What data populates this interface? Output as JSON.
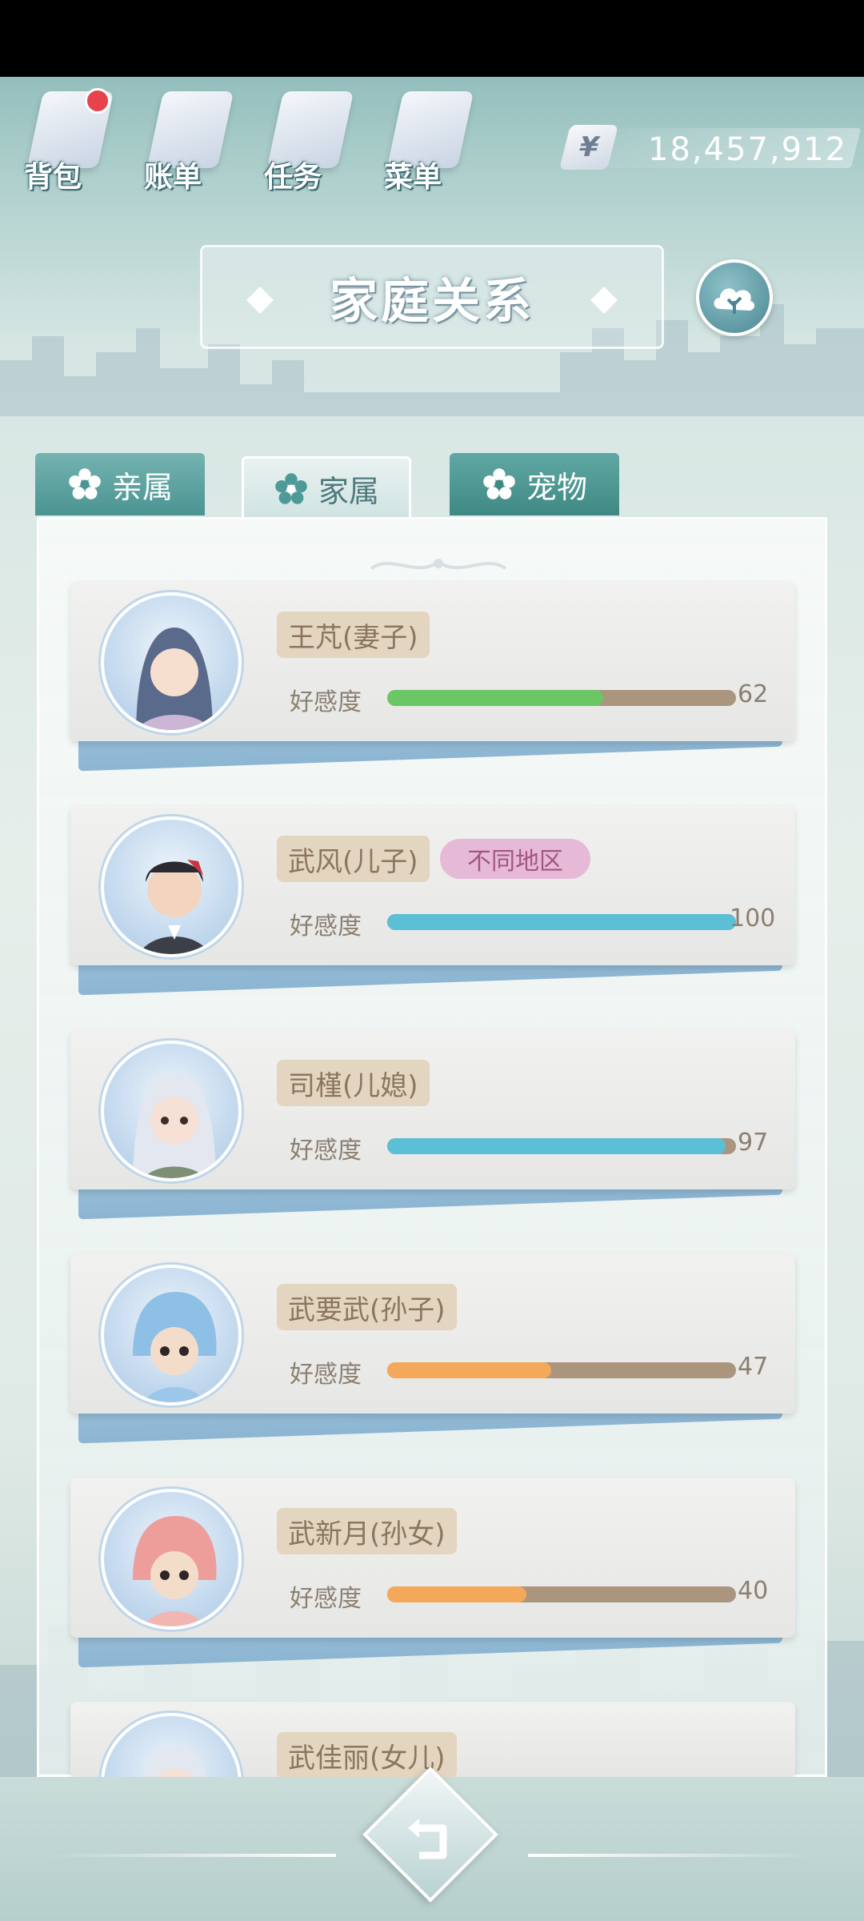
{
  "toolbar": {
    "items": [
      {
        "label": "背包",
        "icon": "bag-icon",
        "notification": true
      },
      {
        "label": "账单",
        "icon": "bill-icon",
        "notification": false
      },
      {
        "label": "任务",
        "icon": "task-icon",
        "notification": false
      },
      {
        "label": "菜单",
        "icon": "menu-icon",
        "notification": false
      }
    ],
    "currency_symbol": "¥",
    "currency_amount": "18,457,912"
  },
  "header": {
    "title": "家庭关系"
  },
  "tabs": [
    {
      "label": "亲属",
      "active": false
    },
    {
      "label": "家属",
      "active": true
    },
    {
      "label": "宠物",
      "active": false
    }
  ],
  "favor_label": "好感度",
  "members": [
    {
      "name": "王芃(妻子)",
      "badge": "",
      "favor": 62,
      "bar_color": "#6bc766"
    },
    {
      "name": "武风(儿子)",
      "badge": "不同地区",
      "favor": 100,
      "bar_color": "#5bbfd6"
    },
    {
      "name": "司槿(儿媳)",
      "badge": "",
      "favor": 97,
      "bar_color": "#5bbfd6"
    },
    {
      "name": "武要武(孙子)",
      "badge": "",
      "favor": 47,
      "bar_color": "#f3a85a"
    },
    {
      "name": "武新月(孙女)",
      "badge": "",
      "favor": 40,
      "bar_color": "#f3a85a"
    },
    {
      "name": "武佳丽(女儿)",
      "badge": "",
      "favor": null,
      "bar_color": ""
    }
  ],
  "colors": {
    "accent_teal": "#4a9492",
    "bar_track": "#ac957f"
  }
}
